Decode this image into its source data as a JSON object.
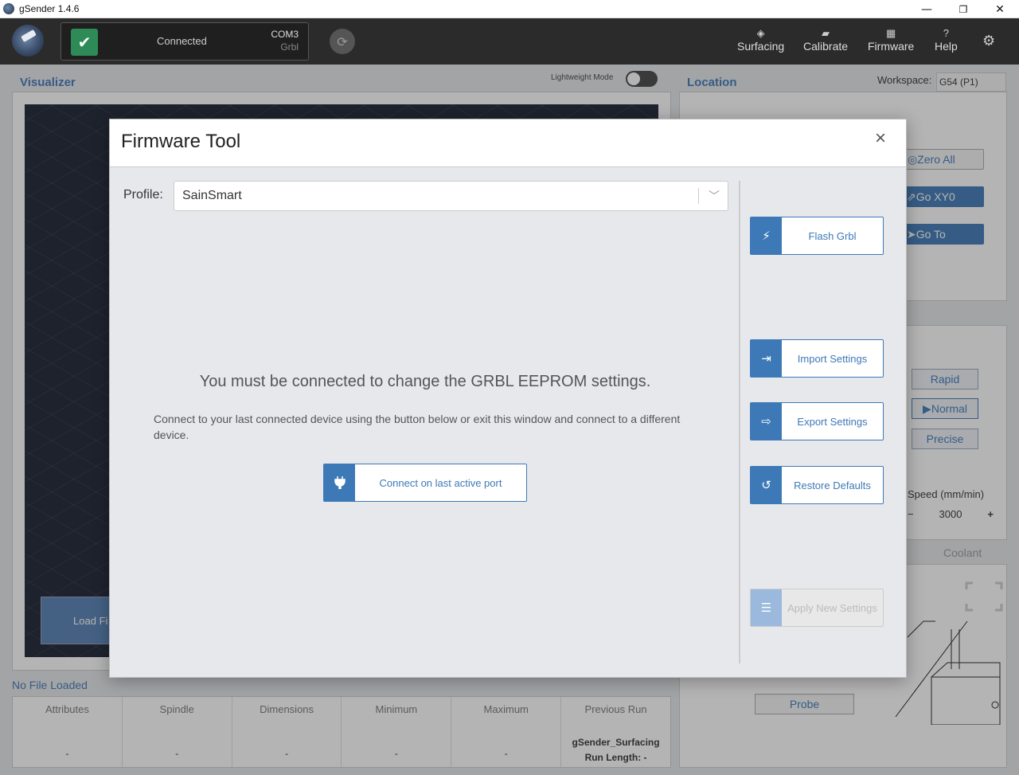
{
  "window": {
    "title": "gSender 1.4.6",
    "minimize": "—",
    "maximize": "❐",
    "close": "✕"
  },
  "header": {
    "connection": {
      "status": "Connected",
      "port": "COM3",
      "firmware": "Grbl"
    },
    "nav": [
      {
        "label": "Surfacing",
        "icon": "surfacing-icon"
      },
      {
        "label": "Calibrate",
        "icon": "calibrate-icon"
      },
      {
        "label": "Firmware",
        "icon": "firmware-icon"
      },
      {
        "label": "Help",
        "icon": "help-icon"
      }
    ]
  },
  "visualizer": {
    "title": "Visualizer",
    "lightweight_label": "Lightweight Mode",
    "load_file": "Load Fi"
  },
  "location": {
    "title": "Location",
    "workspace_label": "Workspace:",
    "workspace_value": "G54 (P1)",
    "zero_all": "Zero All",
    "go_xy0": "Go XY0",
    "go_to": "Go  To"
  },
  "jog": {
    "rapid": "Rapid",
    "normal": "Normal",
    "precise": "Precise",
    "speed_label": "Speed (mm/min)",
    "speed_value": "3000",
    "minus": "−",
    "plus": "+"
  },
  "coolant_label": "Coolant",
  "probe_label": "Probe",
  "file": {
    "status": "No File Loaded",
    "columns": [
      {
        "header": "Attributes",
        "value": "-"
      },
      {
        "header": "Spindle",
        "value": "-"
      },
      {
        "header": "Dimensions",
        "value": "-"
      },
      {
        "header": "Minimum",
        "value": "-"
      },
      {
        "header": "Maximum",
        "value": "-"
      },
      {
        "header": "Previous Run",
        "line1": "gSender_Surfacing",
        "line2": "Run Length: -"
      }
    ]
  },
  "modal": {
    "title": "Firmware Tool",
    "close": "×",
    "profile_label": "Profile:",
    "profile_value": "SainSmart",
    "message": "You must be connected to change the GRBL EEPROM settings.",
    "submessage": "Connect to your last connected device using the button below or exit this window and connect to a different device.",
    "connect_button": "Connect on last active port",
    "buttons": {
      "flash": "Flash Grbl",
      "import": "Import Settings",
      "export": "Export Settings",
      "restore": "Restore Defaults",
      "apply": "Apply New Settings"
    }
  }
}
